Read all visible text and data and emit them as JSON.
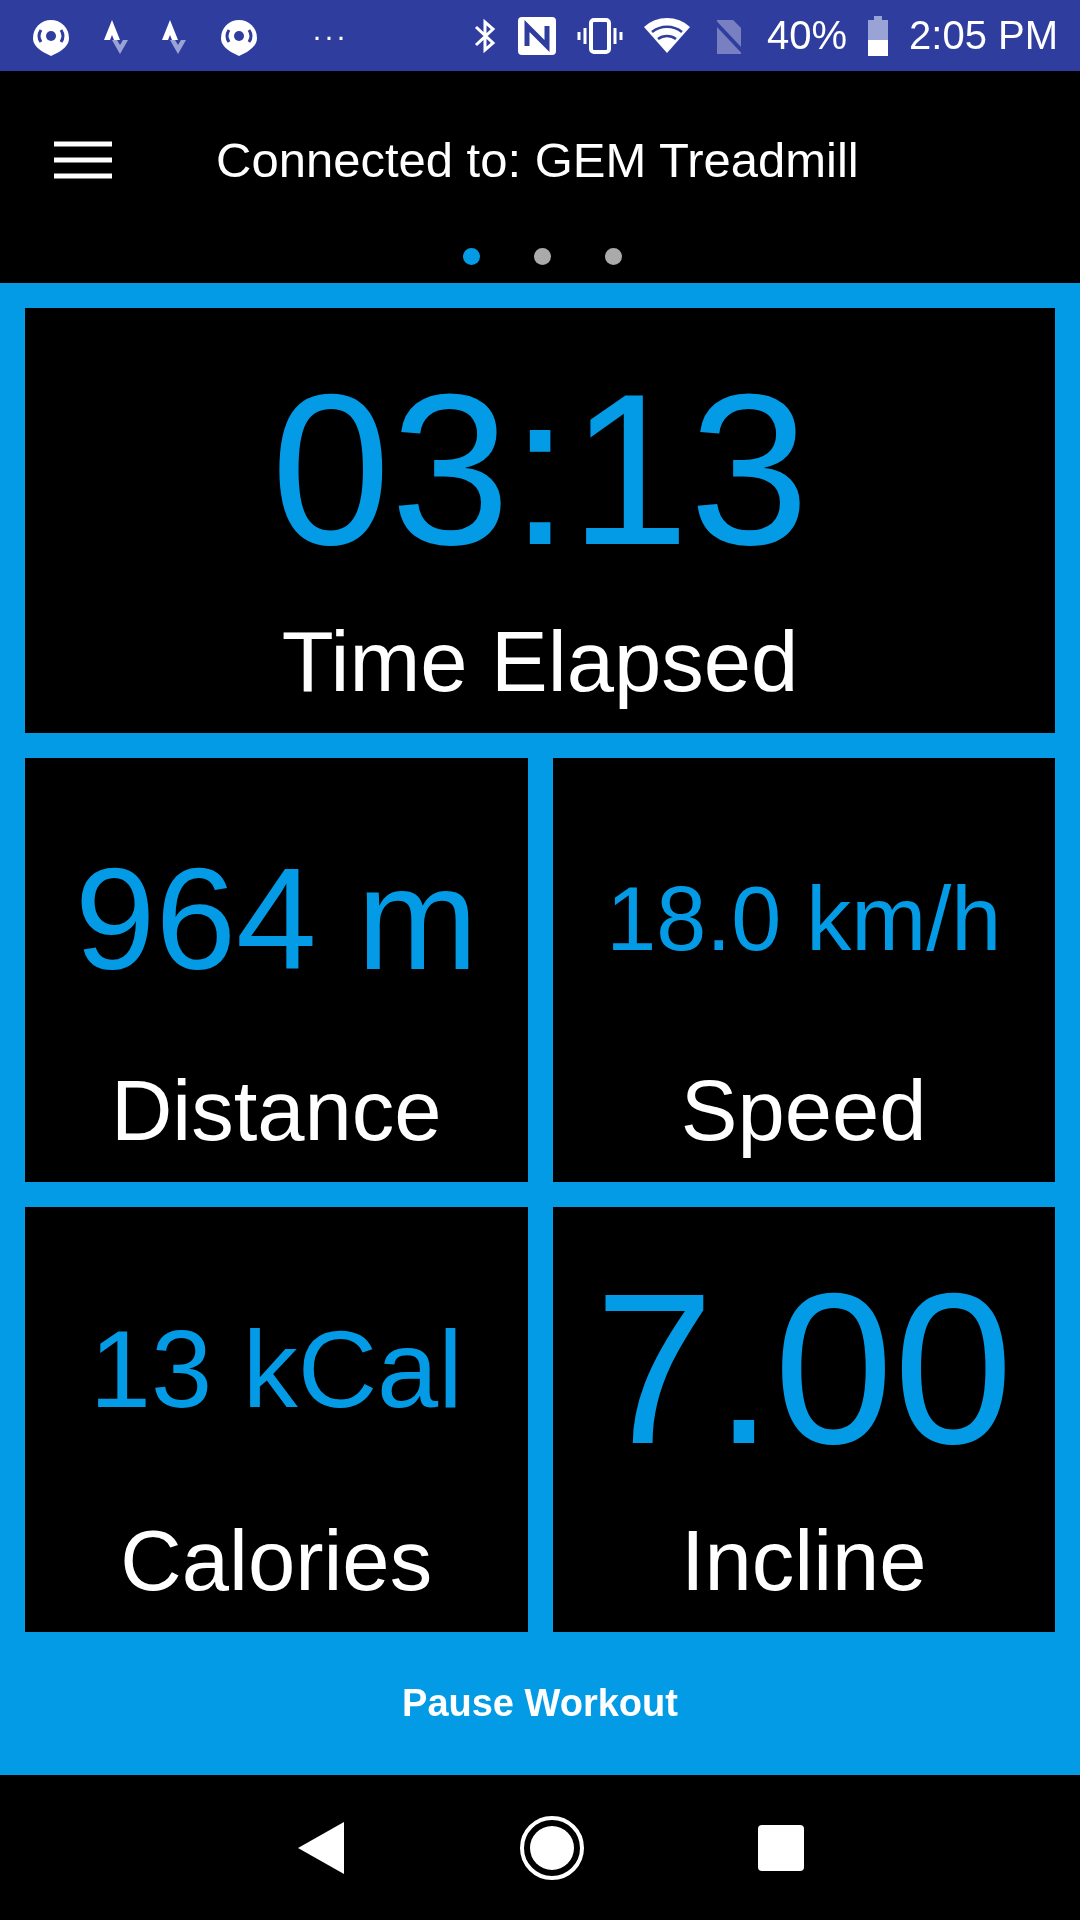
{
  "status_bar": {
    "more": "···",
    "battery": "40%",
    "time": "2:05 PM"
  },
  "app_bar": {
    "title": "Connected to: GEM Treadmill"
  },
  "pages": [
    {
      "selected": true
    },
    {
      "selected": false
    },
    {
      "selected": false
    }
  ],
  "tiles": [
    {
      "value": "03:13",
      "label": "Time Elapsed"
    },
    {
      "value": "964 m",
      "label": "Distance"
    },
    {
      "value": "18.0 km/h",
      "label": "Speed"
    },
    {
      "value": "13 kCal",
      "label": "Calories"
    },
    {
      "value": "7.00",
      "label": "Incline"
    }
  ],
  "pause_button": "Pause Workout"
}
